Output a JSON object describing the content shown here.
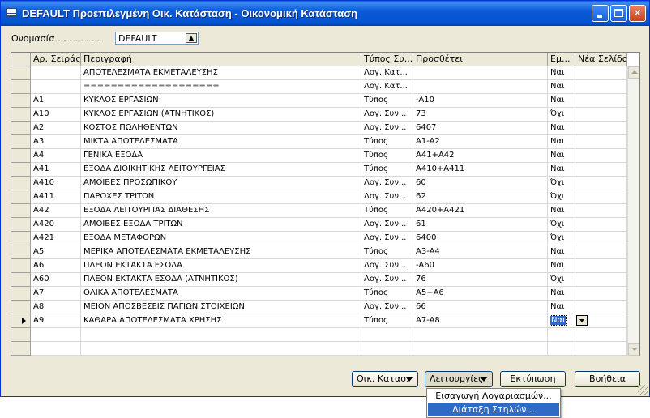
{
  "window": {
    "title": "DEFAULT Προεπιλεγμένη Οικ. Κατάσταση - Οικονομική Κατάσταση"
  },
  "form": {
    "name_label": "Ονομασία . . . . . . . .",
    "name_value": "DEFAULT"
  },
  "grid": {
    "columns": [
      "Αρ. Σειράς",
      "Περιγραφή",
      "Τύπος Συ...",
      "Προσθέτει",
      "Εμ...",
      "Νέα Σελίδα"
    ],
    "rows": [
      {
        "code": "",
        "description": "ΑΠΟΤΕΛΕΣΜΑΤΑ ΕΚΜΕΤΑΛΕΥΣΗΣ",
        "type": "Λογ. Κατ...",
        "adds": "",
        "show": "Ναι"
      },
      {
        "code": "",
        "description": "====================",
        "type": "Λογ. Κατ...",
        "adds": "",
        "show": "Ναι"
      },
      {
        "code": "A1",
        "description": "ΚΥΚΛΟΣ ΕΡΓΑΣΙΩΝ",
        "type": "Τύπος",
        "adds": "-A10",
        "show": "Ναι"
      },
      {
        "code": "A10",
        "description": "ΚΥΚΛΟΣ ΕΡΓΑΣΙΩΝ (ΑΤΝΗΤΙΚΟΣ)",
        "type": "Λογ. Συν...",
        "adds": "73",
        "show": "Όχι"
      },
      {
        "code": "A2",
        "description": "ΚΟΣΤΟΣ ΠΩΛΗΘΕΝΤΩΝ",
        "type": "Λογ. Συν...",
        "adds": "6407",
        "show": "Ναι"
      },
      {
        "code": "A3",
        "description": "ΜΙΚΤΑ ΑΠΟΤΕΛΕΣΜΑΤΑ",
        "type": "Τύπος",
        "adds": "A1-A2",
        "show": "Ναι"
      },
      {
        "code": "A4",
        "description": "ΓΕΝΙΚΑ ΕΞΟΔΑ",
        "type": "Τύπος",
        "adds": "A41+A42",
        "show": "Ναι"
      },
      {
        "code": "A41",
        "description": "ΕΞΟΔΑ ΔΙΟΙΚΗΤΙΚΗΣ ΛΕΙΤΟΥΡΓΕΙΑΣ",
        "type": "Τύπος",
        "adds": "A410+A411",
        "show": "Ναι"
      },
      {
        "code": "A410",
        "description": "ΑΜΟΙΒΕΣ ΠΡΟΣΩΠΙΚΟΥ",
        "type": "Λογ. Συν...",
        "adds": "60",
        "show": "Όχι"
      },
      {
        "code": "A411",
        "description": "ΠΑΡΟΧΕΣ ΤΡΙΤΩΝ",
        "type": "Λογ. Συν...",
        "adds": "62",
        "show": "Όχι"
      },
      {
        "code": "A42",
        "description": "ΕΞΟΔΑ ΛΕΙΤΟΥΡΓΙΑΣ ΔΙΑΘΕΣΗΣ",
        "type": "Τύπος",
        "adds": "A420+A421",
        "show": "Ναι"
      },
      {
        "code": "A420",
        "description": "ΑΜΟΙΒΕΣ ΕΞΟΔΑ ΤΡΙΤΩΝ",
        "type": "Λογ. Συν...",
        "adds": "61",
        "show": "Όχι"
      },
      {
        "code": "A421",
        "description": "ΕΞΟΔΑ ΜΕΤΑΦΟΡΩΝ",
        "type": "Λογ. Συν...",
        "adds": "6400",
        "show": "Όχι"
      },
      {
        "code": "A5",
        "description": "ΜΕΡΙΚΑ ΑΠΟΤΕΛΕΣΜΑΤΑ ΕΚΜΕΤΑΛΕΥΣΗΣ",
        "type": "Τύπος",
        "adds": "A3-A4",
        "show": "Ναι"
      },
      {
        "code": "A6",
        "description": "ΠΛΕΟΝ ΕΚΤΑΚΤΑ ΕΣΟΔΑ",
        "type": "Λογ. Συν...",
        "adds": "-A60",
        "show": "Ναι"
      },
      {
        "code": "A60",
        "description": "ΠΛΕΟΝ ΕΚΤΑΚΤΑ ΕΣΟΔΑ (ΑΤΝΗΤΙΚΟΣ)",
        "type": "Λογ. Συν...",
        "adds": "76",
        "show": "Όχι"
      },
      {
        "code": "A7",
        "description": "ΟΛΙΚΑ ΑΠΟΤΕΛΕΣΜΑΤΑ",
        "type": "Τύπος",
        "adds": "A5+A6",
        "show": "Ναι"
      },
      {
        "code": "A8",
        "description": "ΜΕΙΟΝ ΑΠΟΣΒΕΣΕΙΣ ΠΑΓΙΩΝ ΣΤΟΙΧΕΙΩΝ",
        "type": "Λογ. Συν...",
        "adds": "66",
        "show": "Ναι"
      },
      {
        "code": "A9",
        "description": "ΚΑΘΑΡΑ ΑΠΟΤΕΛΕΣΜΑΤΑ ΧΡΗΣΗΣ",
        "type": "Τύπος",
        "adds": "A7-A8",
        "show": "Ναι",
        "current": true
      }
    ],
    "empty_rows": 2
  },
  "buttons": {
    "statement": "Οικ. Κατασ.",
    "functions": "Λειτουργίες",
    "print": "Εκτύπωση",
    "help": "Βοήθεια"
  },
  "functions_menu": {
    "items": [
      "Εισαγωγή Λογαριασμών...",
      "Διάταξη Στηλών..."
    ],
    "active_index": 1
  },
  "colors": {
    "title_bar": "#0a5ad8",
    "selection": "#316ac5",
    "face": "#ece9d8"
  }
}
